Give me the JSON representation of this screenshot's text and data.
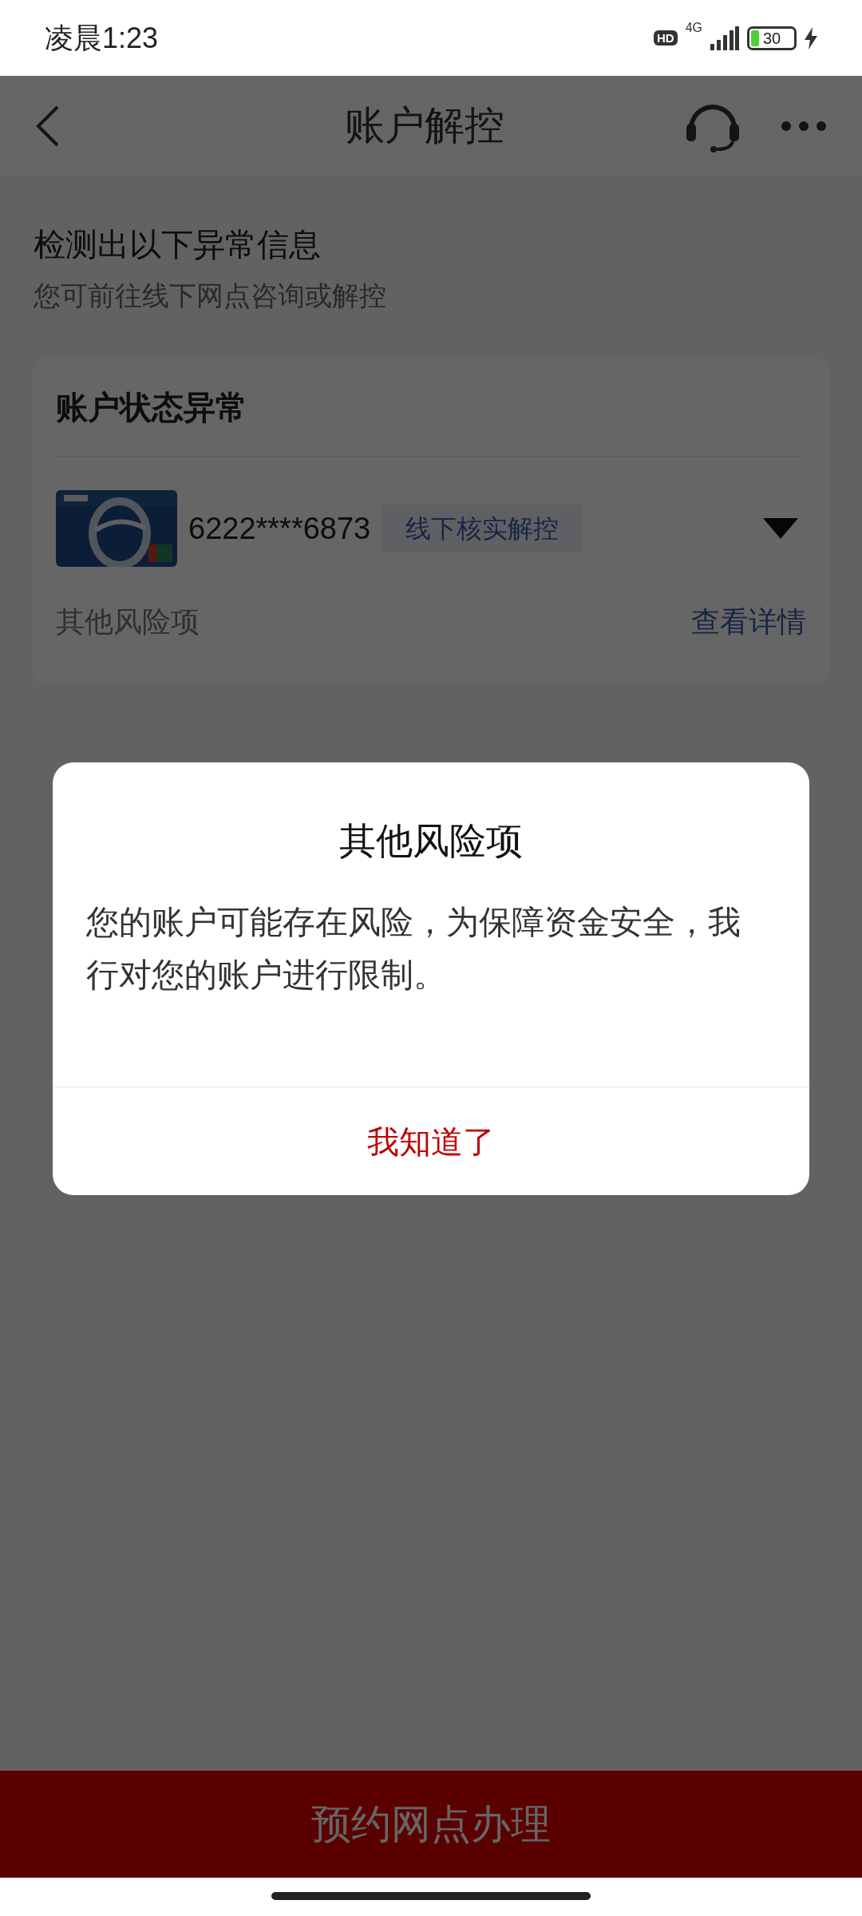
{
  "status_bar": {
    "time": "凌晨1:23",
    "hd_badge": "HD",
    "network": "4G",
    "battery": "30",
    "charging": true
  },
  "nav": {
    "title": "账户解控"
  },
  "header": {
    "title": "检测出以下异常信息",
    "subtitle": "您可前往线下网点咨询或解控"
  },
  "card": {
    "title": "账户状态异常",
    "account": {
      "number": "6222****6873",
      "tag": "线下核实解控"
    },
    "other_risks": {
      "label": "其他风险项",
      "link": "查看详情"
    }
  },
  "dialog": {
    "title": "其他风险项",
    "message": "您的账户可能存在风险，为保障资金安全，我行对您的账户进行限制。",
    "button": "我知道了"
  },
  "bottom_button": "预约网点办理"
}
